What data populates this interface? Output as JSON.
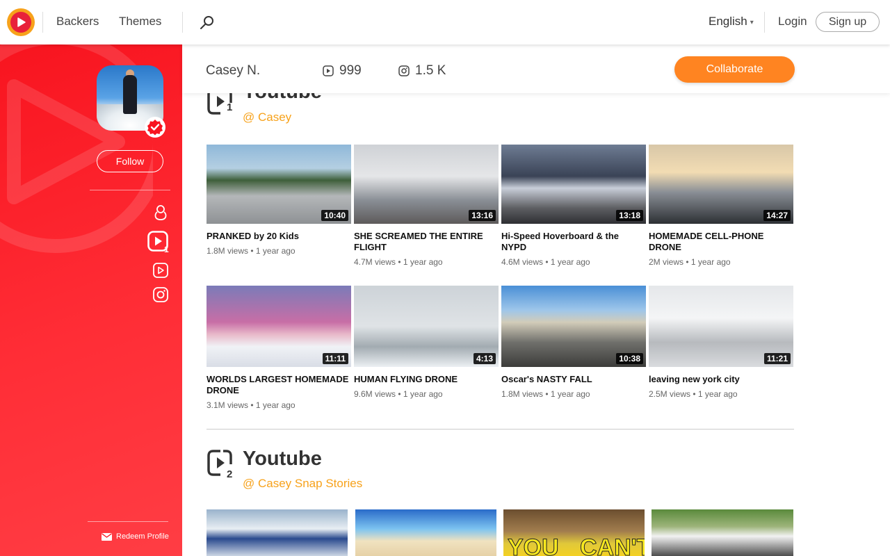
{
  "nav": {
    "backers": "Backers",
    "themes": "Themes",
    "language": "English",
    "login": "Login",
    "signup": "Sign up"
  },
  "sidebar": {
    "follow": "Follow",
    "yt_badge": "1",
    "redeem": "Redeem Profile"
  },
  "profile": {
    "name": "Casey N.",
    "youtube_count": "999",
    "instagram_count": "1.5 K",
    "collaborate": "Collaborate"
  },
  "sections": [
    {
      "title": "Youtube",
      "badge": "1",
      "handle": "@ Casey",
      "videos": [
        {
          "title": "PRANKED by 20 Kids",
          "meta": "1.8M views • 1 year ago",
          "duration": "10:40"
        },
        {
          "title": "SHE SCREAMED THE ENTIRE FLIGHT",
          "meta": "4.7M views • 1 year ago",
          "duration": "13:16"
        },
        {
          "title": "Hi-Speed Hoverboard & the NYPD",
          "meta": "4.6M views • 1 year ago",
          "duration": "13:18"
        },
        {
          "title": "HOMEMADE CELL-PHONE DRONE",
          "meta": "2M views • 1 year ago",
          "duration": "14:27"
        },
        {
          "title": "WORLDS LARGEST HOMEMADE DRONE",
          "meta": "3.1M views • 1 year ago",
          "duration": "11:11"
        },
        {
          "title": "HUMAN FLYING DRONE",
          "meta": "9.6M views • 1 year ago",
          "duration": "4:13"
        },
        {
          "title": "Oscar's NASTY FALL",
          "meta": "1.8M views • 1 year ago",
          "duration": "10:38"
        },
        {
          "title": "leaving new york city",
          "meta": "2.5M views • 1 year ago",
          "duration": "11:21"
        }
      ]
    },
    {
      "title": "Youtube",
      "badge": "2",
      "handle": "@ Casey Snap Stories",
      "thumb_texts": [
        "YOU",
        "CAN'T"
      ]
    }
  ],
  "colors": {
    "brand_red": "#f8141f",
    "accent_orange": "#ff8421",
    "handle_orange": "#f7a21b"
  }
}
